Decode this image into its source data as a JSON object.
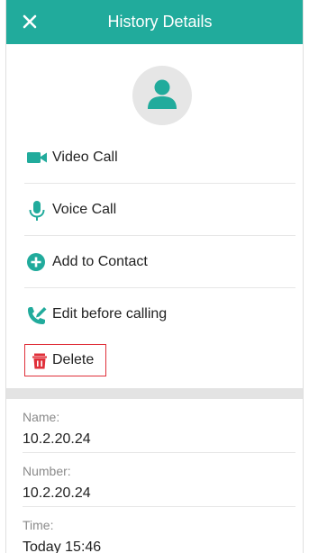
{
  "header": {
    "title": "History Details",
    "close_icon": "close-icon"
  },
  "accent_color": "#21ab9c",
  "danger_color": "#e0303a",
  "actions": [
    {
      "label": "Video Call",
      "icon": "video-camera-icon"
    },
    {
      "label": "Voice Call",
      "icon": "microphone-icon"
    },
    {
      "label": "Add to Contact",
      "icon": "add-circle-icon"
    },
    {
      "label": "Edit before calling",
      "icon": "edit-phone-icon"
    }
  ],
  "delete": {
    "label": "Delete",
    "icon": "trash-icon"
  },
  "details": [
    {
      "key": "Name:",
      "value": "10.2.20.24"
    },
    {
      "key": "Number:",
      "value": "10.2.20.24"
    },
    {
      "key": "Time:",
      "value": "Today 15:46"
    }
  ]
}
